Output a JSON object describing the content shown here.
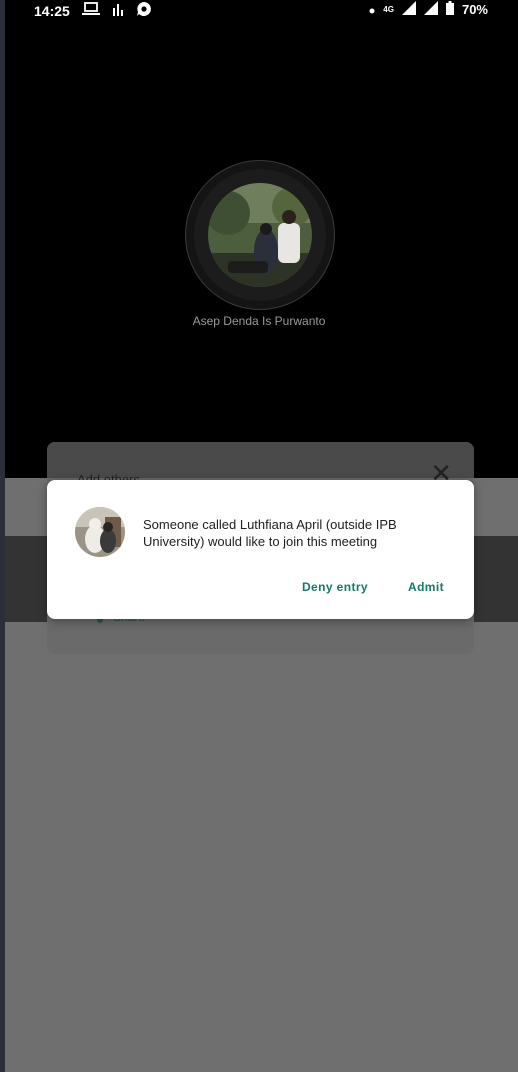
{
  "status_bar": {
    "time": "14:25",
    "network_type": "4G",
    "battery": "70%"
  },
  "participant": {
    "name": "Asep Denda Is Purwanto"
  },
  "background_sheet": {
    "title": "Add others",
    "share_label": "Share"
  },
  "dialog": {
    "message": "Someone called Luthfiana April (outside IPB University) would like to join this meeting",
    "deny_label": "Deny entry",
    "admit_label": "Admit"
  },
  "colors": {
    "accent": "#137a6b",
    "background": "#000000",
    "scrim": "#6f6f6f"
  },
  "icons": [
    "laptop-icon",
    "signal-bars-icon",
    "chat-bubble-icon",
    "dot-icon",
    "mobile-signal-icon",
    "battery-icon",
    "close-icon",
    "share-icon"
  ]
}
